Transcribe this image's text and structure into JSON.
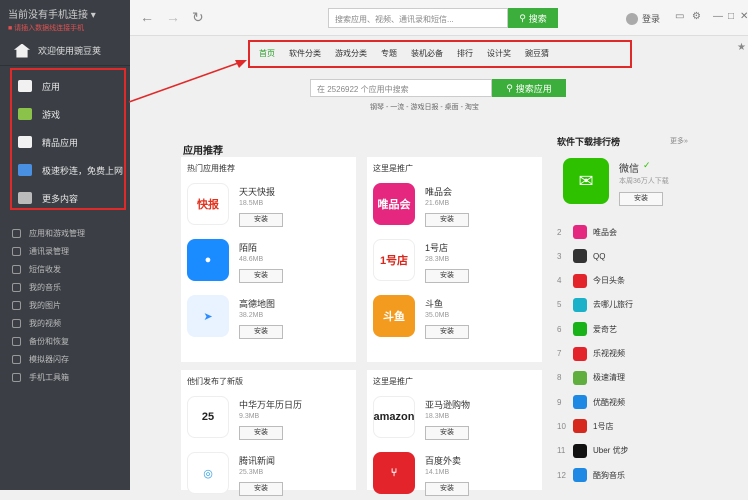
{
  "sidebar": {
    "account_title": "当前没有手机连接 ▾",
    "account_sub": "■ 请插入数据线连接手机",
    "welcome": "欢迎使用豌豆荚",
    "main_items": [
      {
        "label": "应用",
        "color": "#f1f1f1"
      },
      {
        "label": "游戏",
        "color": "#8bc34a"
      },
      {
        "label": "精品应用",
        "color": "#f1f1f1"
      },
      {
        "label": "极速秒连，免费上网",
        "color": "#4a90e2"
      },
      {
        "label": "更多内容",
        "color": "#bbbbbb"
      }
    ],
    "sub_items": [
      "应用和游戏管理",
      "通讯录管理",
      "短信收发",
      "我的音乐",
      "我的图片",
      "我的视频",
      "备份和恢复",
      "模拟器闪存",
      "手机工具箱"
    ]
  },
  "topbar": {
    "search_placeholder": "搜索应用、视频、通讯录和短信...",
    "search_button": "搜索",
    "login": "登录"
  },
  "tabs": [
    "首页",
    "软件分类",
    "游戏分类",
    "专题",
    "装机必备",
    "排行",
    "设计奖",
    "豌豆猜"
  ],
  "main_search": {
    "placeholder": "在 2526922 个应用中搜索",
    "button": "搜索应用",
    "hotwords": "钢琴 - 一流 - 游戏日报 - 桌面 - 淘宝"
  },
  "section_title": "应用推荐",
  "cards": [
    {
      "title": "热门应用推荐",
      "apps": [
        {
          "name": "天天快报",
          "size": "18.5MB",
          "install": "安装",
          "icon": "快报",
          "color": "#ffffff",
          "fg": "#e0321e"
        },
        {
          "name": "陌陌",
          "size": "48.6MB",
          "install": "安装",
          "icon": "●",
          "color": "#1a8cff",
          "fg": "#ffffff"
        },
        {
          "name": "高德地图",
          "size": "38.2MB",
          "install": "安装",
          "icon": "➤",
          "color": "#e8f3ff",
          "fg": "#2f8cff"
        }
      ]
    },
    {
      "title": "这里是推广",
      "apps": [
        {
          "name": "唯品会",
          "size": "21.6MB",
          "install": "安装",
          "icon": "唯品会",
          "color": "#e5277f",
          "fg": "#ffffff"
        },
        {
          "name": "1号店",
          "size": "28.3MB",
          "install": "安装",
          "icon": "1号店",
          "color": "#ffffff",
          "fg": "#d6281c"
        },
        {
          "name": "斗鱼",
          "size": "35.0MB",
          "install": "安装",
          "icon": "斗鱼",
          "color": "#f39b1f",
          "fg": "#ffffff"
        }
      ]
    },
    {
      "title": "他们发布了新版",
      "apps": [
        {
          "name": "中华万年历日历",
          "size": "9.3MB",
          "install": "安装",
          "icon": "25",
          "color": "#ffffff",
          "fg": "#222222"
        },
        {
          "name": "腾讯新闻",
          "size": "25.3MB",
          "install": "安装",
          "icon": "◎",
          "color": "#ffffff",
          "fg": "#2e9fe5"
        }
      ]
    },
    {
      "title": "这里是推广",
      "apps": [
        {
          "name": "亚马逊购物",
          "size": "18.3MB",
          "install": "安装",
          "icon": "amazon",
          "color": "#ffffff",
          "fg": "#222222"
        },
        {
          "name": "百度外卖",
          "size": "14.1MB",
          "install": "安装",
          "icon": "⑂",
          "color": "#e3242b",
          "fg": "#ffffff"
        }
      ]
    }
  ],
  "ranking": {
    "title": "软件下载排行榜",
    "more": "更多»",
    "top": {
      "name": "微信",
      "sub": "本周36万人下载",
      "install": "安装",
      "color": "#2dc100"
    },
    "rows": [
      {
        "num": "2",
        "name": "唯品会",
        "color": "#e5277f"
      },
      {
        "num": "3",
        "name": "QQ",
        "color": "#333333"
      },
      {
        "num": "4",
        "name": "今日头条",
        "color": "#e3242b"
      },
      {
        "num": "5",
        "name": "去哪儿旅行",
        "color": "#1bb1c9"
      },
      {
        "num": "6",
        "name": "爱奇艺",
        "color": "#19b319"
      },
      {
        "num": "7",
        "name": "乐视视频",
        "color": "#e3242b"
      },
      {
        "num": "8",
        "name": "极速清理",
        "color": "#5fae3e"
      },
      {
        "num": "9",
        "name": "优酷视频",
        "color": "#1e88e5"
      },
      {
        "num": "10",
        "name": "1号店",
        "color": "#d6281c"
      },
      {
        "num": "11",
        "name": "Uber 优步",
        "color": "#111111"
      },
      {
        "num": "12",
        "name": "酷狗音乐",
        "color": "#1e88e5"
      }
    ]
  }
}
